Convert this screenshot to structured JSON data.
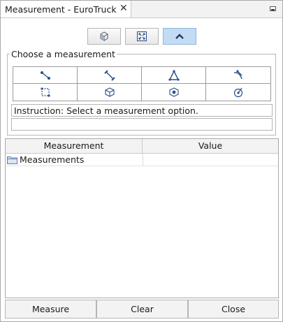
{
  "window": {
    "tab_title": "Measurement - EuroTruck",
    "close_glyph": "✕"
  },
  "toolbar": {
    "buttons": [
      {
        "icon": "view-cube-icon",
        "active": false
      },
      {
        "icon": "fit-view-icon",
        "active": false
      },
      {
        "icon": "chevron-up-icon",
        "active": true
      }
    ]
  },
  "measure_group": {
    "title": "Choose a measurement",
    "options": [
      {
        "icon": "point-to-point-icon"
      },
      {
        "icon": "minimum-distance-icon"
      },
      {
        "icon": "angle-icon"
      },
      {
        "icon": "arc-angle-icon"
      },
      {
        "icon": "area-icon"
      },
      {
        "icon": "volume-icon"
      },
      {
        "icon": "center-of-gravity-icon"
      },
      {
        "icon": "circle-diameter-icon"
      }
    ],
    "instruction": "Instruction: Select a measurement option.",
    "result": ""
  },
  "table": {
    "columns": [
      "Measurement",
      "Value"
    ],
    "rows": [
      {
        "label": "Measurements",
        "value": "",
        "icon": "folder-icon"
      }
    ]
  },
  "buttons": {
    "measure": "Measure",
    "clear": "Clear",
    "close": "Close"
  },
  "colors": {
    "active_toolbar": "#c4dcf3",
    "icon_blue": "#2a4f8a"
  }
}
